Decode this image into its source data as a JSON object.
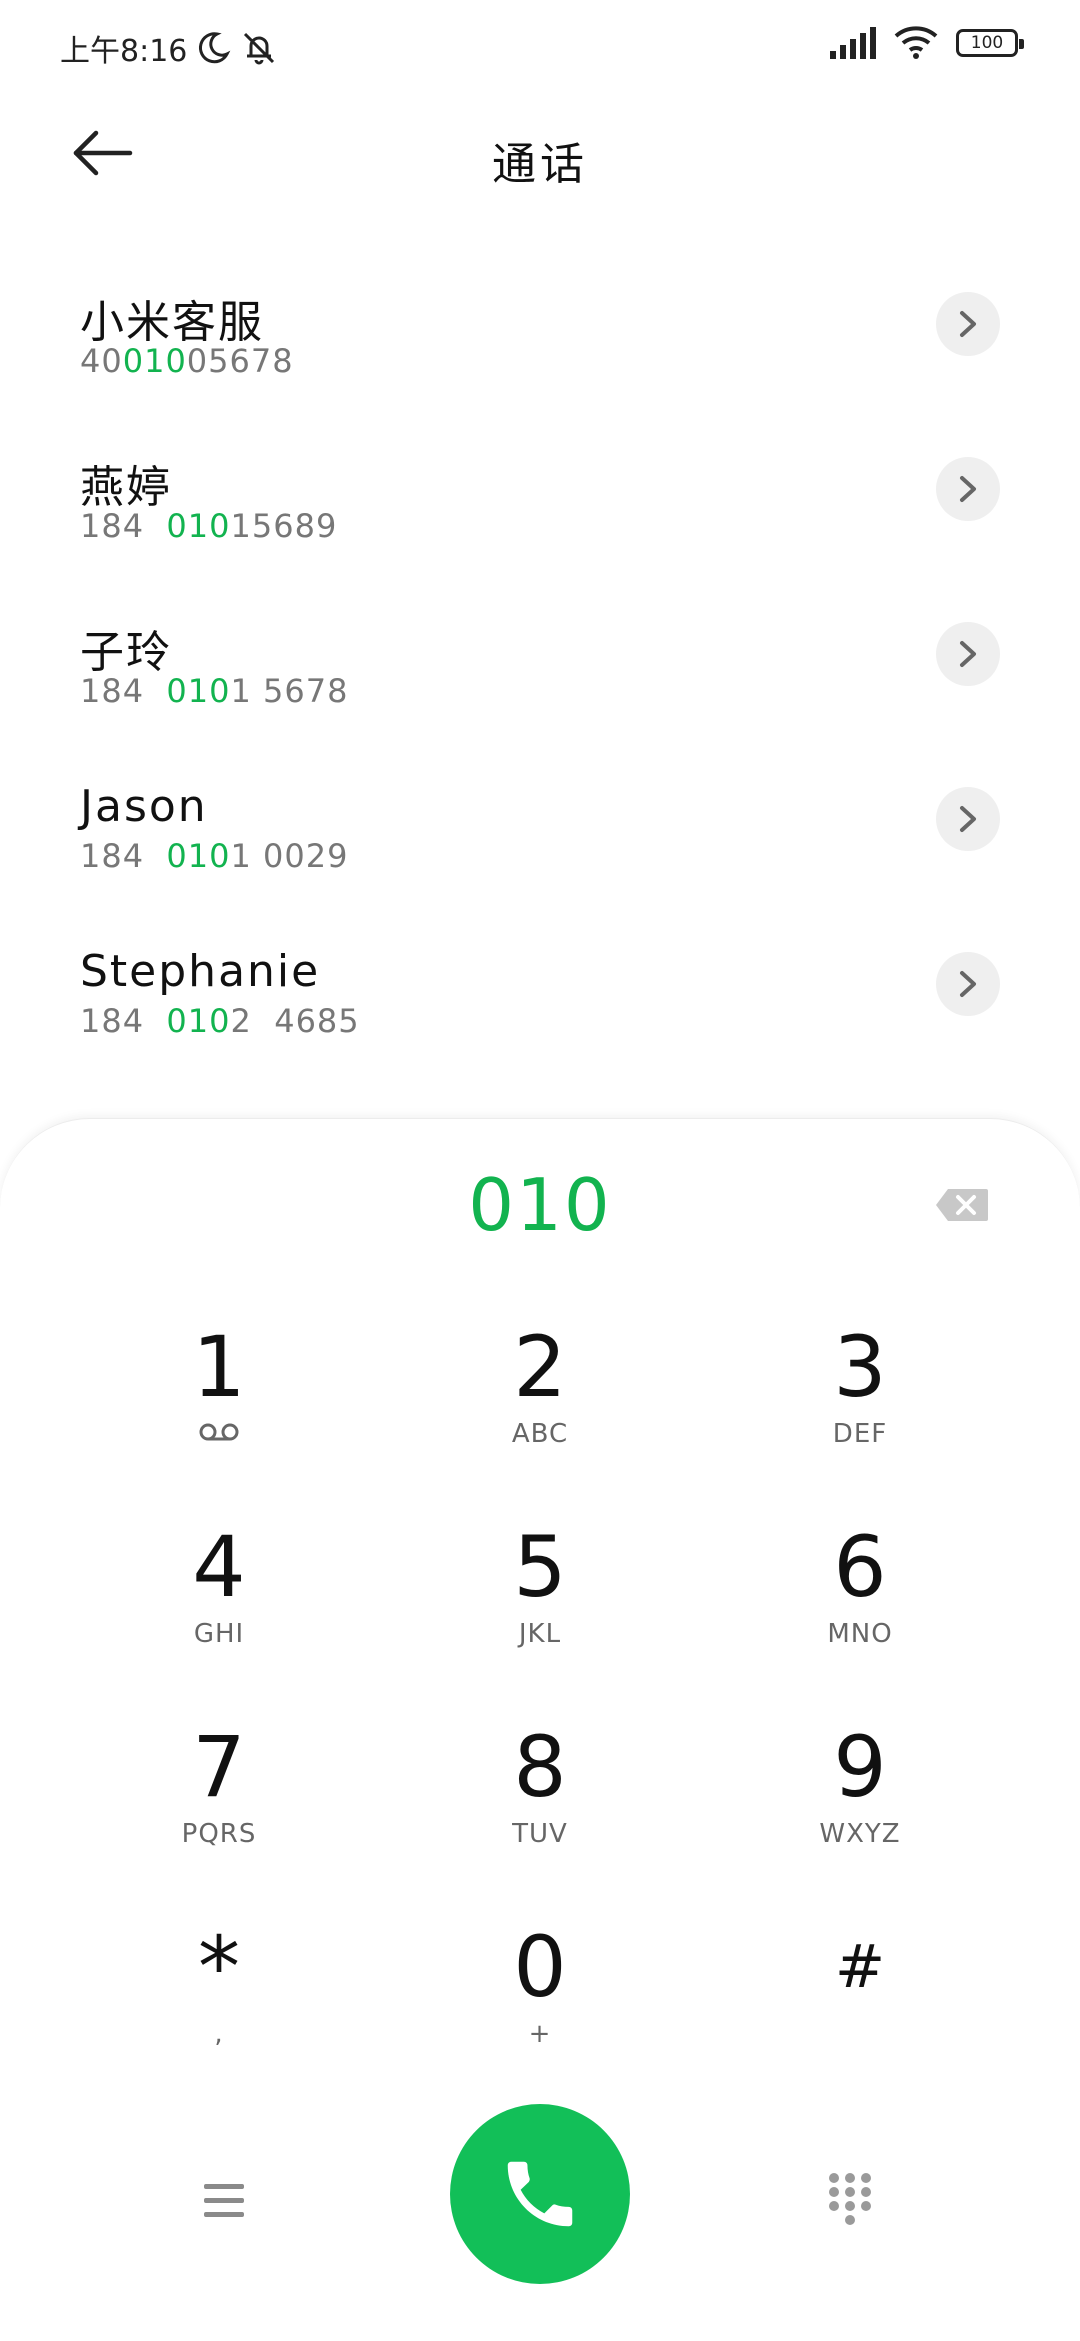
{
  "status_bar": {
    "time": "上午8:16",
    "battery": "100"
  },
  "header": {
    "title": "通话"
  },
  "contacts": [
    {
      "name": "小米客服",
      "number_pre": "40",
      "number_hl": "010",
      "number_post": "05678"
    },
    {
      "name": "燕婷",
      "number_pre": "184  ",
      "number_hl": "010",
      "number_post": "15689"
    },
    {
      "name": "子玲",
      "number_pre": "184  ",
      "number_hl": "010",
      "number_post": "1 5678"
    },
    {
      "name": "Jason",
      "number_pre": "184  ",
      "number_hl": "010",
      "number_post": "1 0029"
    },
    {
      "name": "Stephanie",
      "number_pre": "184  ",
      "number_hl": "010",
      "number_post": "2  4685"
    }
  ],
  "dialer": {
    "input_value": "010",
    "keys": [
      {
        "digit": "1",
        "letters": ""
      },
      {
        "digit": "2",
        "letters": "ABC"
      },
      {
        "digit": "3",
        "letters": "DEF"
      },
      {
        "digit": "4",
        "letters": "GHI"
      },
      {
        "digit": "5",
        "letters": "JKL"
      },
      {
        "digit": "6",
        "letters": "MNO"
      },
      {
        "digit": "7",
        "letters": "PQRS"
      },
      {
        "digit": "8",
        "letters": "TUV"
      },
      {
        "digit": "9",
        "letters": "WXYZ"
      },
      {
        "digit": "*",
        "letters": ","
      },
      {
        "digit": "0",
        "letters": "+"
      },
      {
        "digit": "#",
        "letters": ""
      }
    ]
  },
  "colors": {
    "accent": "#12b34f",
    "call_button": "#12bf58"
  },
  "icons": {
    "voicemail": "voicemail-icon",
    "back": "back-arrow-icon",
    "chevron": "chevron-right-icon",
    "delete": "backspace-icon",
    "call": "phone-icon",
    "menu": "menu-icon",
    "grid": "dialpad-grid-icon"
  }
}
